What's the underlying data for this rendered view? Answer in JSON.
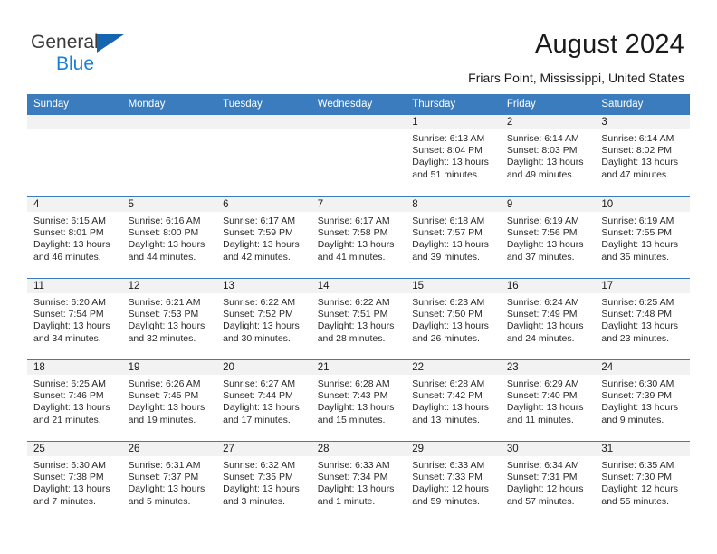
{
  "brand": {
    "name_part1": "General",
    "name_part2": "Blue",
    "flag_icon": "triangle-flag-icon",
    "accent_color": "#1b7fd4",
    "flag_color": "#1565b0"
  },
  "header": {
    "title": "August 2024",
    "location": "Friars Point, Mississippi, United States"
  },
  "calendar": {
    "header_color": "#3a7cbe",
    "daynum_band_color": "#f2f2f2",
    "weekdays": [
      "Sunday",
      "Monday",
      "Tuesday",
      "Wednesday",
      "Thursday",
      "Friday",
      "Saturday"
    ],
    "labels": {
      "sunrise": "Sunrise:",
      "sunset": "Sunset:",
      "daylight": "Daylight:"
    },
    "weeks": [
      [
        {
          "day": "",
          "sunrise": "",
          "sunset": "",
          "daylight_line1": "",
          "daylight_line2": "",
          "empty": true
        },
        {
          "day": "",
          "sunrise": "",
          "sunset": "",
          "daylight_line1": "",
          "daylight_line2": "",
          "empty": true
        },
        {
          "day": "",
          "sunrise": "",
          "sunset": "",
          "daylight_line1": "",
          "daylight_line2": "",
          "empty": true
        },
        {
          "day": "",
          "sunrise": "",
          "sunset": "",
          "daylight_line1": "",
          "daylight_line2": "",
          "empty": true
        },
        {
          "day": "1",
          "sunrise": "Sunrise: 6:13 AM",
          "sunset": "Sunset: 8:04 PM",
          "daylight_line1": "Daylight: 13 hours",
          "daylight_line2": "and 51 minutes.",
          "empty": false
        },
        {
          "day": "2",
          "sunrise": "Sunrise: 6:14 AM",
          "sunset": "Sunset: 8:03 PM",
          "daylight_line1": "Daylight: 13 hours",
          "daylight_line2": "and 49 minutes.",
          "empty": false
        },
        {
          "day": "3",
          "sunrise": "Sunrise: 6:14 AM",
          "sunset": "Sunset: 8:02 PM",
          "daylight_line1": "Daylight: 13 hours",
          "daylight_line2": "and 47 minutes.",
          "empty": false
        }
      ],
      [
        {
          "day": "4",
          "sunrise": "Sunrise: 6:15 AM",
          "sunset": "Sunset: 8:01 PM",
          "daylight_line1": "Daylight: 13 hours",
          "daylight_line2": "and 46 minutes.",
          "empty": false
        },
        {
          "day": "5",
          "sunrise": "Sunrise: 6:16 AM",
          "sunset": "Sunset: 8:00 PM",
          "daylight_line1": "Daylight: 13 hours",
          "daylight_line2": "and 44 minutes.",
          "empty": false
        },
        {
          "day": "6",
          "sunrise": "Sunrise: 6:17 AM",
          "sunset": "Sunset: 7:59 PM",
          "daylight_line1": "Daylight: 13 hours",
          "daylight_line2": "and 42 minutes.",
          "empty": false
        },
        {
          "day": "7",
          "sunrise": "Sunrise: 6:17 AM",
          "sunset": "Sunset: 7:58 PM",
          "daylight_line1": "Daylight: 13 hours",
          "daylight_line2": "and 41 minutes.",
          "empty": false
        },
        {
          "day": "8",
          "sunrise": "Sunrise: 6:18 AM",
          "sunset": "Sunset: 7:57 PM",
          "daylight_line1": "Daylight: 13 hours",
          "daylight_line2": "and 39 minutes.",
          "empty": false
        },
        {
          "day": "9",
          "sunrise": "Sunrise: 6:19 AM",
          "sunset": "Sunset: 7:56 PM",
          "daylight_line1": "Daylight: 13 hours",
          "daylight_line2": "and 37 minutes.",
          "empty": false
        },
        {
          "day": "10",
          "sunrise": "Sunrise: 6:19 AM",
          "sunset": "Sunset: 7:55 PM",
          "daylight_line1": "Daylight: 13 hours",
          "daylight_line2": "and 35 minutes.",
          "empty": false
        }
      ],
      [
        {
          "day": "11",
          "sunrise": "Sunrise: 6:20 AM",
          "sunset": "Sunset: 7:54 PM",
          "daylight_line1": "Daylight: 13 hours",
          "daylight_line2": "and 34 minutes.",
          "empty": false
        },
        {
          "day": "12",
          "sunrise": "Sunrise: 6:21 AM",
          "sunset": "Sunset: 7:53 PM",
          "daylight_line1": "Daylight: 13 hours",
          "daylight_line2": "and 32 minutes.",
          "empty": false
        },
        {
          "day": "13",
          "sunrise": "Sunrise: 6:22 AM",
          "sunset": "Sunset: 7:52 PM",
          "daylight_line1": "Daylight: 13 hours",
          "daylight_line2": "and 30 minutes.",
          "empty": false
        },
        {
          "day": "14",
          "sunrise": "Sunrise: 6:22 AM",
          "sunset": "Sunset: 7:51 PM",
          "daylight_line1": "Daylight: 13 hours",
          "daylight_line2": "and 28 minutes.",
          "empty": false
        },
        {
          "day": "15",
          "sunrise": "Sunrise: 6:23 AM",
          "sunset": "Sunset: 7:50 PM",
          "daylight_line1": "Daylight: 13 hours",
          "daylight_line2": "and 26 minutes.",
          "empty": false
        },
        {
          "day": "16",
          "sunrise": "Sunrise: 6:24 AM",
          "sunset": "Sunset: 7:49 PM",
          "daylight_line1": "Daylight: 13 hours",
          "daylight_line2": "and 24 minutes.",
          "empty": false
        },
        {
          "day": "17",
          "sunrise": "Sunrise: 6:25 AM",
          "sunset": "Sunset: 7:48 PM",
          "daylight_line1": "Daylight: 13 hours",
          "daylight_line2": "and 23 minutes.",
          "empty": false
        }
      ],
      [
        {
          "day": "18",
          "sunrise": "Sunrise: 6:25 AM",
          "sunset": "Sunset: 7:46 PM",
          "daylight_line1": "Daylight: 13 hours",
          "daylight_line2": "and 21 minutes.",
          "empty": false
        },
        {
          "day": "19",
          "sunrise": "Sunrise: 6:26 AM",
          "sunset": "Sunset: 7:45 PM",
          "daylight_line1": "Daylight: 13 hours",
          "daylight_line2": "and 19 minutes.",
          "empty": false
        },
        {
          "day": "20",
          "sunrise": "Sunrise: 6:27 AM",
          "sunset": "Sunset: 7:44 PM",
          "daylight_line1": "Daylight: 13 hours",
          "daylight_line2": "and 17 minutes.",
          "empty": false
        },
        {
          "day": "21",
          "sunrise": "Sunrise: 6:28 AM",
          "sunset": "Sunset: 7:43 PM",
          "daylight_line1": "Daylight: 13 hours",
          "daylight_line2": "and 15 minutes.",
          "empty": false
        },
        {
          "day": "22",
          "sunrise": "Sunrise: 6:28 AM",
          "sunset": "Sunset: 7:42 PM",
          "daylight_line1": "Daylight: 13 hours",
          "daylight_line2": "and 13 minutes.",
          "empty": false
        },
        {
          "day": "23",
          "sunrise": "Sunrise: 6:29 AM",
          "sunset": "Sunset: 7:40 PM",
          "daylight_line1": "Daylight: 13 hours",
          "daylight_line2": "and 11 minutes.",
          "empty": false
        },
        {
          "day": "24",
          "sunrise": "Sunrise: 6:30 AM",
          "sunset": "Sunset: 7:39 PM",
          "daylight_line1": "Daylight: 13 hours",
          "daylight_line2": "and 9 minutes.",
          "empty": false
        }
      ],
      [
        {
          "day": "25",
          "sunrise": "Sunrise: 6:30 AM",
          "sunset": "Sunset: 7:38 PM",
          "daylight_line1": "Daylight: 13 hours",
          "daylight_line2": "and 7 minutes.",
          "empty": false
        },
        {
          "day": "26",
          "sunrise": "Sunrise: 6:31 AM",
          "sunset": "Sunset: 7:37 PM",
          "daylight_line1": "Daylight: 13 hours",
          "daylight_line2": "and 5 minutes.",
          "empty": false
        },
        {
          "day": "27",
          "sunrise": "Sunrise: 6:32 AM",
          "sunset": "Sunset: 7:35 PM",
          "daylight_line1": "Daylight: 13 hours",
          "daylight_line2": "and 3 minutes.",
          "empty": false
        },
        {
          "day": "28",
          "sunrise": "Sunrise: 6:33 AM",
          "sunset": "Sunset: 7:34 PM",
          "daylight_line1": "Daylight: 13 hours",
          "daylight_line2": "and 1 minute.",
          "empty": false
        },
        {
          "day": "29",
          "sunrise": "Sunrise: 6:33 AM",
          "sunset": "Sunset: 7:33 PM",
          "daylight_line1": "Daylight: 12 hours",
          "daylight_line2": "and 59 minutes.",
          "empty": false
        },
        {
          "day": "30",
          "sunrise": "Sunrise: 6:34 AM",
          "sunset": "Sunset: 7:31 PM",
          "daylight_line1": "Daylight: 12 hours",
          "daylight_line2": "and 57 minutes.",
          "empty": false
        },
        {
          "day": "31",
          "sunrise": "Sunrise: 6:35 AM",
          "sunset": "Sunset: 7:30 PM",
          "daylight_line1": "Daylight: 12 hours",
          "daylight_line2": "and 55 minutes.",
          "empty": false
        }
      ]
    ]
  }
}
